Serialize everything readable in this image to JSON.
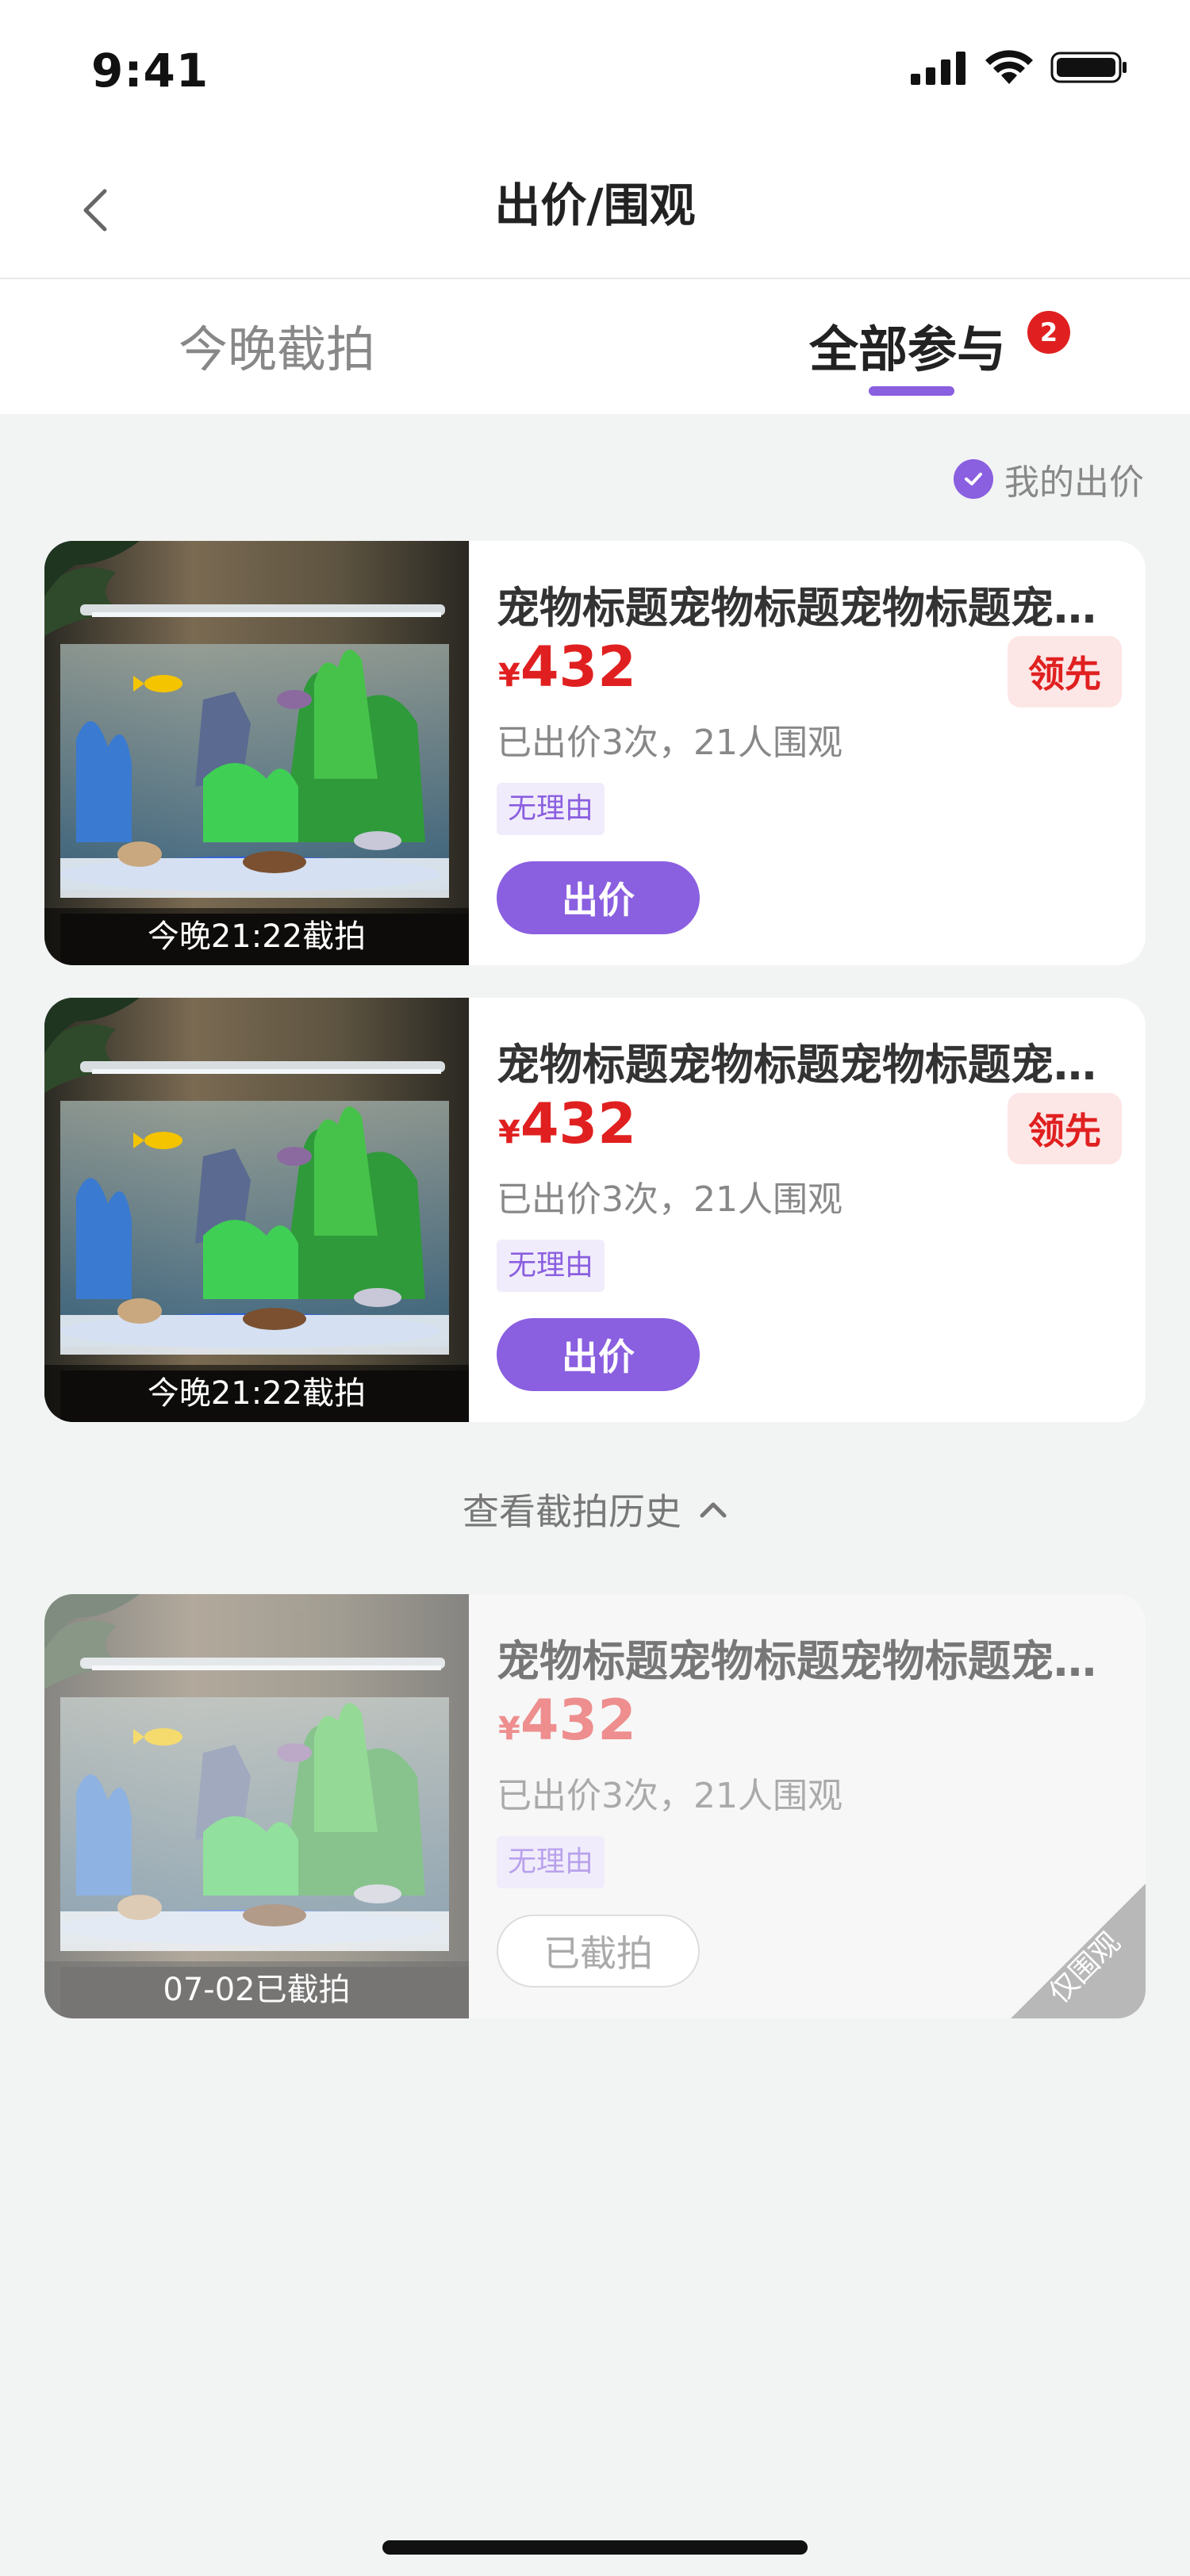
{
  "status_bar": {
    "time": "9:41"
  },
  "nav": {
    "title": "出价/围观"
  },
  "tabs": {
    "tonight_label": "今晚截拍",
    "all_label": "全部参与",
    "all_badge": "2"
  },
  "filter": {
    "label": "我的出价"
  },
  "items": [
    {
      "title": "宠物标题宠物标题宠物标题宠物标题",
      "currency": "¥",
      "price": "432",
      "status_badge": "领先",
      "stats": "已出价3次，21人围观",
      "tag": "无理由",
      "button": "出价",
      "caption": "今晚21:22截拍"
    },
    {
      "title": "宠物标题宠物标题宠物标题宠物标题",
      "currency": "¥",
      "price": "432",
      "status_badge": "领先",
      "stats": "已出价3次，21人围观",
      "tag": "无理由",
      "button": "出价",
      "caption": "今晚21:22截拍"
    }
  ],
  "history": {
    "label": "查看截拍历史"
  },
  "history_items": [
    {
      "title": "宠物标题宠物标题宠物标题宠物标题",
      "currency": "¥",
      "price": "432",
      "stats": "已出价3次，21人围观",
      "tag": "无理由",
      "button": "已截拍",
      "caption": "07-02已截拍",
      "corner_label": "仅围观"
    }
  ],
  "colors": {
    "accent": "#8a5fe0",
    "price_red": "#e02020",
    "background": "#f2f3f3"
  }
}
